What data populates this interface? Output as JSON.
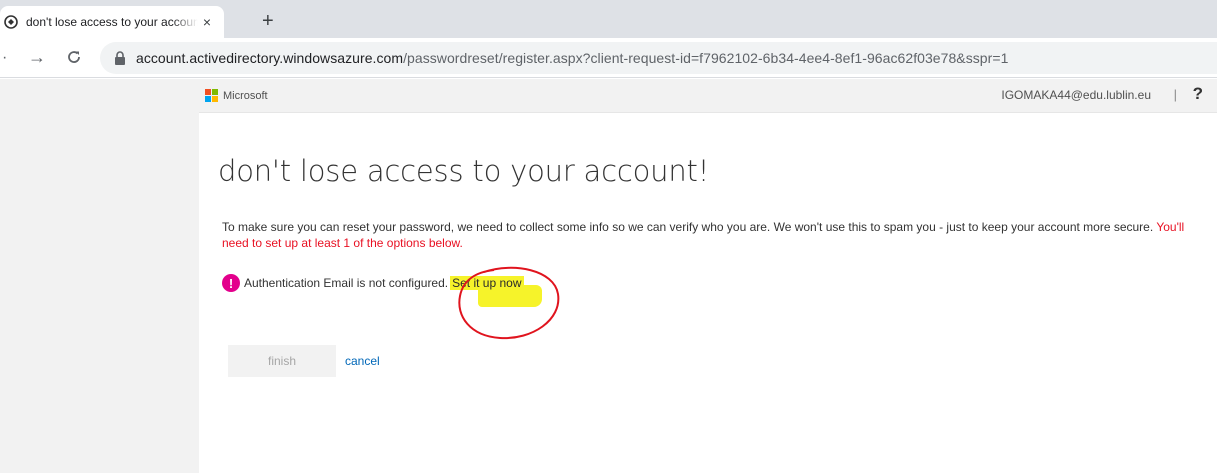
{
  "browser": {
    "tab_title": "don't lose access to your account",
    "tab_close": "×",
    "new_tab": "+",
    "url_host": "account.activedirectory.windowsazure.com",
    "url_rest": "/passwordreset/register.aspx?client-request-id=f7962102-6b34-4ee4-8ef1-96ac62f03e78&sspr=1"
  },
  "header": {
    "brand": "Microsoft",
    "user_email": "IGOMAKA44@edu.lublin.eu",
    "separator": "|",
    "help": "?"
  },
  "main": {
    "heading": "don't lose access to your account!",
    "intro": "To make sure you can reset your password, we need to collect some info so we can verify who you are. We won't use this to spam you - just to keep your account more secure. ",
    "intro_required": "You'll need to set up at least 1 of the options below.",
    "status_text": "Authentication Email is not configured.",
    "setup_link": "Set it up now",
    "finish_label": "finish",
    "cancel_label": "cancel"
  },
  "colors": {
    "required_text": "#e81123",
    "alert_icon": "#e3008c",
    "link": "#0067b8",
    "highlight": "#f6f32a",
    "annotation": "#e0141e"
  },
  "icons": [
    "azure-favicon-icon",
    "close-icon",
    "plus-icon",
    "back-arrow-icon",
    "forward-arrow-icon",
    "reload-icon",
    "lock-icon",
    "microsoft-logo-icon",
    "help-icon",
    "alert-icon"
  ]
}
